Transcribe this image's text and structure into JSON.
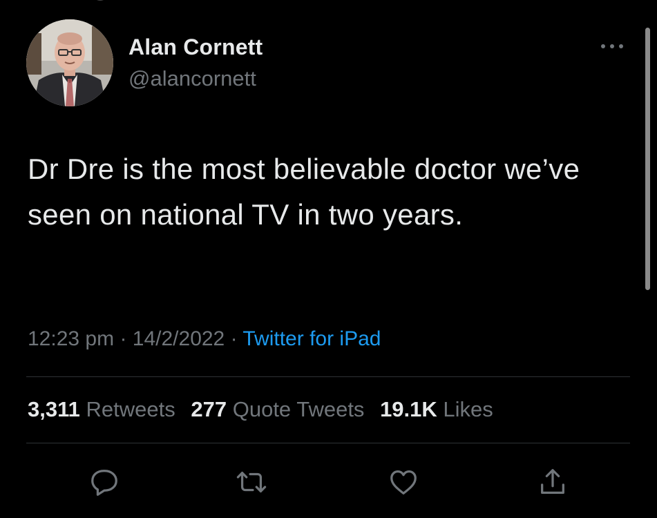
{
  "user": {
    "display_name": "Alan Cornett",
    "handle": "@alancornett"
  },
  "tweet": {
    "text": "Dr Dre is the most believable doctor we’ve seen on national TV in two years.",
    "time": "12:23 pm",
    "date": "14/2/2022",
    "separator": "·",
    "source": "Twitter for iPad"
  },
  "stats": {
    "retweets_count": "3,311",
    "retweets_label": "Retweets",
    "quotes_count": "277",
    "quotes_label": "Quote Tweets",
    "likes_count": "19.1K",
    "likes_label": "Likes"
  },
  "icons": {
    "more": "more-dots-icon",
    "reply": "reply-icon",
    "retweet": "retweet-icon",
    "like": "heart-icon",
    "share": "share-icon"
  },
  "colors": {
    "background": "#000000",
    "primary_text": "#e7e9ea",
    "secondary_text": "#71767b",
    "link": "#1d9bf0",
    "divider": "#2f3336"
  }
}
